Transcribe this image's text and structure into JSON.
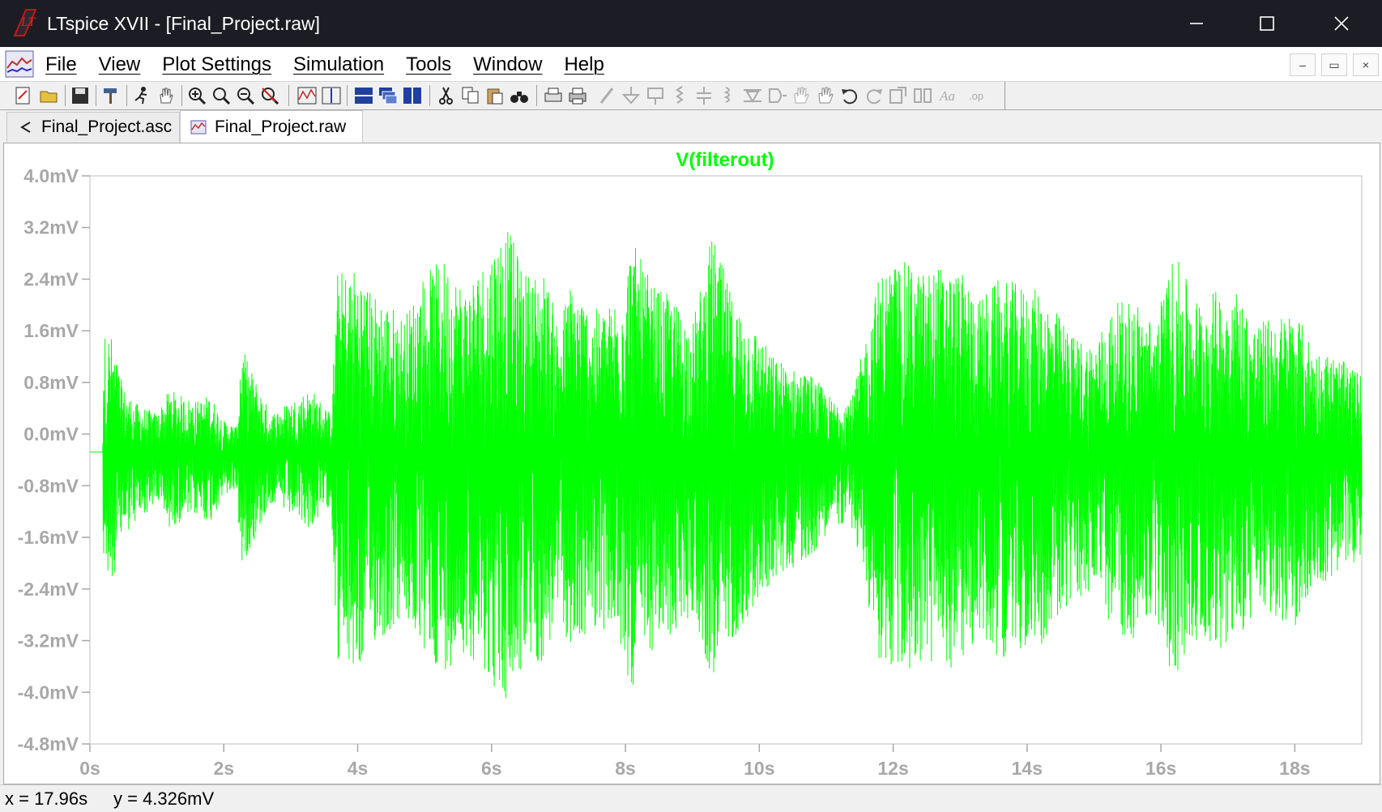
{
  "window": {
    "title": "LTspice XVII - [Final_Project.raw]"
  },
  "menu": [
    "File",
    "View",
    "Plot Settings",
    "Simulation",
    "Tools",
    "Window",
    "Help"
  ],
  "mdi_controls": [
    "–",
    "▭",
    "×"
  ],
  "tabs": [
    {
      "label": "Final_Project.asc",
      "icon": "schematic-icon",
      "active": false
    },
    {
      "label": "Final_Project.raw",
      "icon": "waveform-icon",
      "active": true
    }
  ],
  "colors": {
    "trace": "#00ff00",
    "axis_text": "#a8a8a8",
    "title_bar": "#1c1c24"
  },
  "chart_data": {
    "type": "line",
    "title": "V(filterout)",
    "xlabel": "",
    "ylabel": "",
    "x_ticks": [
      "0s",
      "2s",
      "4s",
      "6s",
      "8s",
      "10s",
      "12s",
      "14s",
      "16s",
      "18s"
    ],
    "y_ticks": [
      "4.0mV",
      "3.2mV",
      "2.4mV",
      "1.6mV",
      "0.8mV",
      "0.0mV",
      "-0.8mV",
      "-1.6mV",
      "-2.4mV",
      "-3.2mV",
      "-4.0mV",
      "-4.8mV"
    ],
    "xlim": [
      0,
      19
    ],
    "ylim": [
      -4.8,
      4.0
    ],
    "x_unit": "s",
    "y_unit": "mV",
    "offset_mV": -0.28,
    "series": [
      {
        "name": "V(filterout)",
        "envelope_max": [
          [
            0.0,
            0
          ],
          [
            0.19,
            0
          ],
          [
            0.2,
            1.8
          ],
          [
            0.3,
            1.9
          ],
          [
            0.5,
            1.0
          ],
          [
            0.7,
            0.75
          ],
          [
            1.0,
            0.6
          ],
          [
            1.2,
            1.0
          ],
          [
            1.3,
            0.9
          ],
          [
            1.6,
            0.8
          ],
          [
            1.8,
            0.9
          ],
          [
            2.0,
            0.5
          ],
          [
            2.2,
            0.4
          ],
          [
            2.25,
            1.7
          ],
          [
            2.4,
            1.3
          ],
          [
            2.7,
            0.6
          ],
          [
            3.0,
            0.8
          ],
          [
            3.3,
            1.0
          ],
          [
            3.6,
            0.6
          ],
          [
            3.7,
            2.8
          ],
          [
            4.0,
            2.9
          ],
          [
            4.2,
            2.5
          ],
          [
            4.4,
            2.4
          ],
          [
            4.7,
            2.1
          ],
          [
            5.0,
            2.8
          ],
          [
            5.3,
            3.0
          ],
          [
            5.6,
            2.6
          ],
          [
            5.9,
            3.0
          ],
          [
            6.2,
            3.6
          ],
          [
            6.5,
            2.8
          ],
          [
            6.8,
            2.8
          ],
          [
            7.0,
            2.0
          ],
          [
            7.2,
            2.7
          ],
          [
            7.5,
            2.2
          ],
          [
            7.8,
            2.3
          ],
          [
            8.1,
            3.3
          ],
          [
            8.4,
            2.6
          ],
          [
            8.7,
            2.4
          ],
          [
            9.0,
            2.0
          ],
          [
            9.3,
            3.4
          ],
          [
            9.6,
            2.4
          ],
          [
            9.9,
            2.0
          ],
          [
            10.2,
            1.5
          ],
          [
            10.5,
            1.3
          ],
          [
            10.8,
            1.2
          ],
          [
            11.1,
            0.8
          ],
          [
            11.4,
            0.9
          ],
          [
            11.8,
            2.8
          ],
          [
            12.1,
            3.0
          ],
          [
            12.4,
            2.8
          ],
          [
            12.7,
            2.9
          ],
          [
            13.0,
            2.8
          ],
          [
            13.3,
            2.4
          ],
          [
            13.6,
            2.7
          ],
          [
            13.9,
            2.6
          ],
          [
            14.2,
            2.5
          ],
          [
            14.5,
            2.1
          ],
          [
            14.7,
            1.8
          ],
          [
            15.0,
            1.7
          ],
          [
            15.3,
            2.3
          ],
          [
            15.6,
            2.4
          ],
          [
            15.9,
            2.0
          ],
          [
            16.2,
            3.1
          ],
          [
            16.5,
            2.4
          ],
          [
            16.8,
            2.5
          ],
          [
            17.1,
            2.6
          ],
          [
            17.4,
            2.0
          ],
          [
            17.7,
            2.1
          ],
          [
            18.0,
            2.2
          ],
          [
            18.3,
            1.6
          ],
          [
            18.6,
            1.5
          ],
          [
            19.0,
            1.2
          ]
        ],
        "envelope_min": [
          [
            0.0,
            0
          ],
          [
            0.19,
            0
          ],
          [
            0.2,
            -2.0
          ],
          [
            0.3,
            -2.2
          ],
          [
            0.5,
            -1.3
          ],
          [
            0.7,
            -1.1
          ],
          [
            1.0,
            -0.8
          ],
          [
            1.2,
            -1.2
          ],
          [
            1.3,
            -1.1
          ],
          [
            1.6,
            -1.0
          ],
          [
            1.8,
            -1.1
          ],
          [
            2.0,
            -0.7
          ],
          [
            2.2,
            -0.6
          ],
          [
            2.25,
            -1.8
          ],
          [
            2.4,
            -1.5
          ],
          [
            2.7,
            -0.8
          ],
          [
            3.0,
            -1.0
          ],
          [
            3.3,
            -1.2
          ],
          [
            3.6,
            -0.8
          ],
          [
            3.7,
            -3.3
          ],
          [
            4.0,
            -3.5
          ],
          [
            4.2,
            -3.0
          ],
          [
            4.4,
            -2.9
          ],
          [
            4.7,
            -2.6
          ],
          [
            5.0,
            -3.2
          ],
          [
            5.3,
            -3.4
          ],
          [
            5.6,
            -3.1
          ],
          [
            5.9,
            -3.4
          ],
          [
            6.2,
            -4.0
          ],
          [
            6.5,
            -3.3
          ],
          [
            6.8,
            -3.3
          ],
          [
            7.0,
            -2.5
          ],
          [
            7.2,
            -3.2
          ],
          [
            7.5,
            -2.7
          ],
          [
            7.8,
            -2.8
          ],
          [
            8.1,
            -3.7
          ],
          [
            8.4,
            -3.1
          ],
          [
            8.7,
            -2.9
          ],
          [
            9.0,
            -2.5
          ],
          [
            9.3,
            -3.6
          ],
          [
            9.6,
            -2.9
          ],
          [
            9.9,
            -2.5
          ],
          [
            10.2,
            -2.0
          ],
          [
            10.5,
            -1.8
          ],
          [
            10.8,
            -1.6
          ],
          [
            11.1,
            -1.1
          ],
          [
            11.4,
            -1.2
          ],
          [
            11.8,
            -3.3
          ],
          [
            12.1,
            -3.5
          ],
          [
            12.4,
            -3.3
          ],
          [
            12.7,
            -3.4
          ],
          [
            13.0,
            -3.3
          ],
          [
            13.3,
            -2.9
          ],
          [
            13.6,
            -3.2
          ],
          [
            13.9,
            -3.1
          ],
          [
            14.2,
            -3.0
          ],
          [
            14.5,
            -2.6
          ],
          [
            14.7,
            -2.3
          ],
          [
            15.0,
            -2.2
          ],
          [
            15.3,
            -2.8
          ],
          [
            15.6,
            -2.9
          ],
          [
            15.9,
            -2.5
          ],
          [
            16.2,
            -3.6
          ],
          [
            16.5,
            -2.9
          ],
          [
            16.8,
            -3.0
          ],
          [
            17.1,
            -3.1
          ],
          [
            17.4,
            -2.5
          ],
          [
            17.7,
            -2.6
          ],
          [
            18.0,
            -2.7
          ],
          [
            18.3,
            -2.1
          ],
          [
            18.6,
            -2.0
          ],
          [
            19.0,
            -1.6
          ]
        ]
      }
    ],
    "grid": false
  },
  "status": {
    "x": "x = 17.96s",
    "y": "y = 4.326mV"
  }
}
